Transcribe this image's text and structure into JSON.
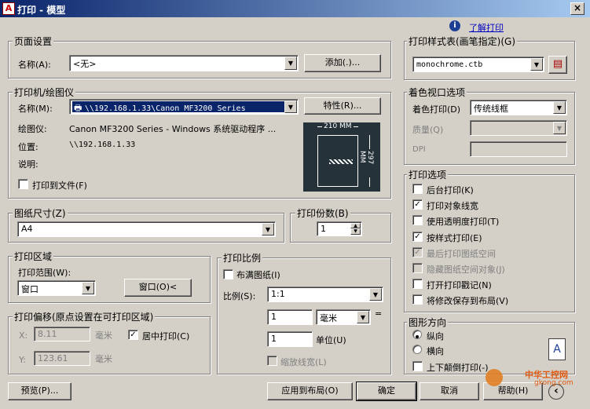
{
  "window": {
    "title": "打印 - 模型",
    "close": "×",
    "icon": "A"
  },
  "help_link": {
    "icon_char": "i",
    "label": "了解打印"
  },
  "page_setup": {
    "group": "页面设置",
    "name_label": "名称(A):",
    "name_value": "<无>",
    "add_button": "添加(.)..."
  },
  "printer": {
    "group": "打印机/绘图仪",
    "name_label": "名称(M):",
    "name_value": "\\\\192.168.1.33\\Canon MF3200 Series",
    "properties_button": "特性(R)...",
    "plotter_label": "绘图仪:",
    "plotter_value": "Canon MF3200 Series - Windows 系统驱动程序 ...",
    "location_label": "位置:",
    "location_value": "\\\\192.168.1.33",
    "description_label": "说明:",
    "print_to_file": "打印到文件(F)",
    "preview_width": "210 MM",
    "preview_height": "297 MM"
  },
  "paper": {
    "group": "图纸尺寸(Z)",
    "value": "A4"
  },
  "copies": {
    "group": "打印份数(B)",
    "value": "1"
  },
  "area": {
    "group": "打印区域",
    "range_label": "打印范围(W):",
    "range_value": "窗口",
    "window_button": "窗口(O)<"
  },
  "offset": {
    "group": "打印偏移(原点设置在可打印区域)",
    "x_label": "X:",
    "x_value": "8.11",
    "x_unit": "毫米",
    "y_label": "Y:",
    "y_value": "123.61",
    "y_unit": "毫米",
    "center": "居中打印(C)"
  },
  "scale": {
    "group": "打印比例",
    "fit": "布满图纸(I)",
    "scale_label": "比例(S):",
    "scale_value": "1:1",
    "value1": "1",
    "unit1": "毫米",
    "equals": "=",
    "value2": "1",
    "unit2_label": "单位(U)",
    "lineweights": "缩放线宽(L)"
  },
  "style_table": {
    "group": "打印样式表(画笔指定)(G)",
    "value": "monochrome.ctb"
  },
  "shaded": {
    "group": "着色视口选项",
    "shade_label": "着色打印(D)",
    "shade_value": "传统线框",
    "quality_label": "质量(Q)",
    "dpi_label": "DPI"
  },
  "options": {
    "group": "打印选项",
    "items": [
      {
        "label": "后台打印(K)",
        "checked": false,
        "disabled": false
      },
      {
        "label": "打印对象线宽",
        "checked": true,
        "disabled": false
      },
      {
        "label": "使用透明度打印(T)",
        "checked": false,
        "disabled": false
      },
      {
        "label": "按样式打印(E)",
        "checked": true,
        "disabled": false
      },
      {
        "label": "最后打印图纸空间",
        "checked": true,
        "disabled": true
      },
      {
        "label": "隐藏图纸空间对象(J)",
        "checked": false,
        "disabled": true
      },
      {
        "label": "打开打印戳记(N)",
        "checked": false,
        "disabled": false
      },
      {
        "label": "将修改保存到布局(V)",
        "checked": false,
        "disabled": false
      }
    ]
  },
  "orientation": {
    "group": "图形方向",
    "portrait": "纵向",
    "landscape": "横向",
    "upside_down": "上下颠倒打印(-)",
    "glyph": "A"
  },
  "buttons": {
    "preview": "预览(P)...",
    "apply": "应用到布局(O)",
    "ok": "确定",
    "cancel": "取消",
    "help": "帮助(H)",
    "chevron": "‹"
  },
  "watermark": {
    "cn": "中华工控网",
    "url": "gkong.com"
  }
}
